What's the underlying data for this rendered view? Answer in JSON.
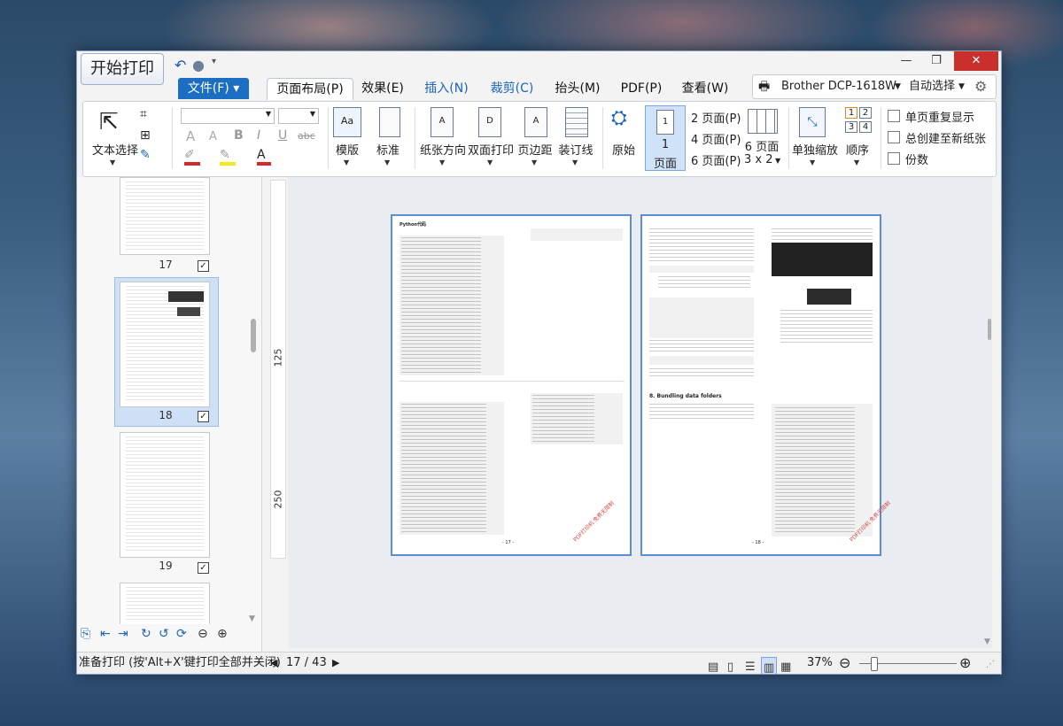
{
  "app": {
    "start_print": "开始打印",
    "quick_access": [
      "undo-icon",
      "circle-icon",
      "customize-icon"
    ],
    "window_controls": [
      "minimize-icon",
      "maximize-icon",
      "close-icon"
    ]
  },
  "tabs": [
    {
      "label": "文件(F)",
      "active": false
    },
    {
      "label": "页面布局(P)",
      "active": true
    },
    {
      "label": "效果(E)",
      "active": false
    },
    {
      "label": "插入(N)",
      "active": false
    },
    {
      "label": "裁剪(C)",
      "active": false
    },
    {
      "label": "抬头(M)",
      "active": false
    },
    {
      "label": "PDF(P)",
      "active": false
    },
    {
      "label": "查看(W)",
      "active": false
    }
  ],
  "printer": {
    "name": "Brother DCP-1618W",
    "mode": "自动选择"
  },
  "ribbon": {
    "text_select": "文本选择",
    "template": "模版",
    "standard": "标准",
    "orientation": "纸张方向",
    "duplex": "双面打印",
    "margins": "页边距",
    "binding": "装订线",
    "original": "原始",
    "one_page_num": "1",
    "one_page_label": "页面",
    "pages_2": "2 页面(P)",
    "pages_4": "4 页面(P)",
    "pages_6": "6 页面(P)",
    "pages_6b_top": "6 页面",
    "pages_6b_bottom": "3 x 2",
    "scale": "单独缩放",
    "order": "顺序",
    "order_nums": [
      "1",
      "2",
      "3",
      "4"
    ],
    "checkbox_repeat": "单页重复显示",
    "checkbox_new_sheet": "总创建至新纸张",
    "checkbox_copies": "份数",
    "format_letters": [
      "A",
      "A",
      "B",
      "I",
      "U",
      "abc"
    ]
  },
  "thumbnails": [
    {
      "page": "17",
      "checked": true
    },
    {
      "page": "18",
      "checked": true,
      "selected": true
    },
    {
      "page": "19",
      "checked": true
    }
  ],
  "ruler": {
    "marks": [
      "125",
      "250"
    ]
  },
  "preview": {
    "left_page_heading": "Python代码",
    "right_page_heading": "8. Bundling data folders",
    "left_page_number": "- 17 -",
    "right_page_number": "- 18 -"
  },
  "status": {
    "text": "准备打印 (按'Alt+X'键打印全部并关闭)",
    "page_indicator": "17 / 43",
    "zoom": "37%"
  }
}
